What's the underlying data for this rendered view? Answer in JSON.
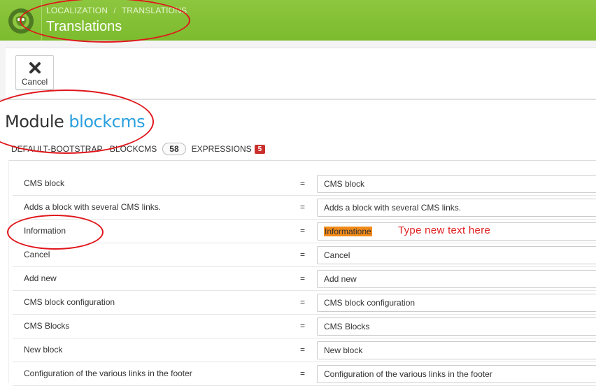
{
  "header": {
    "breadcrumb": [
      "LOCALIZATION",
      "TRANSLATIONS"
    ],
    "breadcrumb_separator": "/",
    "title": "Translations"
  },
  "toolbar": {
    "cancel_label": "Cancel"
  },
  "module": {
    "prefix": "Module",
    "name": "blockcms"
  },
  "subheader": {
    "theme_module": "DEFAULT-BOOTSTRAP - BLOCKCMS",
    "count": "58",
    "expressions_label": "EXPRESSIONS",
    "expressions_count": "5"
  },
  "rows": [
    {
      "key": "CMS block",
      "eq": "=",
      "value": "CMS block"
    },
    {
      "key": "Adds a block with several CMS links.",
      "eq": "=",
      "value": "Adds a block with several CMS links."
    },
    {
      "key": "Information",
      "eq": "=",
      "value": "Informatione"
    },
    {
      "key": "Cancel",
      "eq": "=",
      "value": "Cancel"
    },
    {
      "key": "Add new",
      "eq": "=",
      "value": "Add new"
    },
    {
      "key": "CMS block configuration",
      "eq": "=",
      "value": "CMS block configuration"
    },
    {
      "key": "CMS Blocks",
      "eq": "=",
      "value": "CMS Blocks"
    },
    {
      "key": "New block",
      "eq": "=",
      "value": "New block"
    },
    {
      "key": "Configuration of the various links in the footer",
      "eq": "=",
      "value": "Configuration of the various links in the footer"
    }
  ],
  "annotation": {
    "hint": "Type new text here"
  },
  "colors": {
    "header_green": "#7cbb2e",
    "module_name_blue": "#2aa0e0",
    "highlight_orange": "#f28a18",
    "annotation_red": "#e0161b",
    "badge_red": "#c9302c"
  },
  "icons": {
    "logo": "prestashop-logo-icon",
    "cancel": "close-x-icon"
  }
}
